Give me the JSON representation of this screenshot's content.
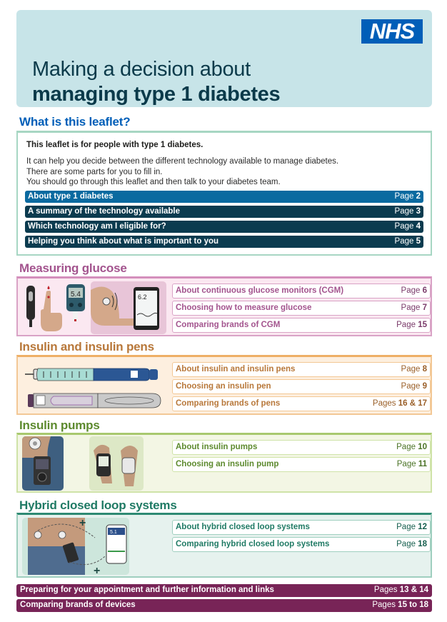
{
  "header": {
    "logo": "NHS",
    "title_line1": "Making a decision about",
    "title_line2": "managing type 1 diabetes"
  },
  "colors": {
    "nhs_blue": "#005eb8",
    "header_bg": "#c7e4e8",
    "intro_heading": "#005eb8",
    "toc_first": "#0a6aa0",
    "toc_dark": "#0b3b4f",
    "glucose": "#a3548e",
    "pens": "#b8783a",
    "pumps": "#5d8a2e",
    "hybrid": "#1f7a64",
    "bottom": "#782457"
  },
  "intro": {
    "heading": "What is this leaflet?",
    "bold_line": "This leaflet is for people with type 1 diabetes.",
    "lines": [
      "It can help you decide between the different technology available to manage diabetes.",
      "There are some parts for you to fill in.",
      "You should go through this leaflet and then talk to your diabetes team."
    ],
    "toc": [
      {
        "label": "About type 1 diabetes",
        "page_prefix": "Page ",
        "page": "2"
      },
      {
        "label": "A summary of the technology available",
        "page_prefix": "Page ",
        "page": "3"
      },
      {
        "label": "Which technology am I eligible for?",
        "page_prefix": "Page ",
        "page": "4"
      },
      {
        "label": "Helping you think about what is important to you",
        "page_prefix": "Page ",
        "page": "5"
      }
    ]
  },
  "glucose": {
    "heading": "Measuring glucose",
    "meter_reading": "5.4",
    "phone_reading": "6.2",
    "links": [
      {
        "label": "About continuous glucose monitors (CGM)",
        "page_prefix": "Page ",
        "page": "6"
      },
      {
        "label": "Choosing how to measure glucose",
        "page_prefix": "Page ",
        "page": "7"
      },
      {
        "label": "Comparing brands of CGM",
        "page_prefix": "Page ",
        "page": "15"
      }
    ]
  },
  "pens": {
    "heading": "Insulin and insulin pens",
    "links": [
      {
        "label": "About insulin and insulin pens",
        "page_prefix": "Page ",
        "page": "8"
      },
      {
        "label": "Choosing an insulin pen",
        "page_prefix": "Page ",
        "page": "9"
      },
      {
        "label": "Comparing brands of pens",
        "page_prefix": "Pages ",
        "page": "16 & 17"
      }
    ]
  },
  "pumps": {
    "heading": "Insulin pumps",
    "links": [
      {
        "label": "About insulin pumps",
        "page_prefix": "Page ",
        "page": "10"
      },
      {
        "label": "Choosing an insulin pump",
        "page_prefix": "Page ",
        "page": "11"
      }
    ]
  },
  "hybrid": {
    "heading": "Hybrid closed loop systems",
    "phone_reading": "5.1",
    "links": [
      {
        "label": "About hybrid closed loop systems",
        "page_prefix": "Page ",
        "page": "12"
      },
      {
        "label": "Comparing hybrid closed loop systems",
        "page_prefix": "Page ",
        "page": "18"
      }
    ]
  },
  "bottom": [
    {
      "label": "Preparing for your appointment and further information and links",
      "page_prefix": "Pages ",
      "page": "13 & 14"
    },
    {
      "label": "Comparing brands of devices",
      "page_prefix": "Pages ",
      "page": "15 to 18"
    }
  ]
}
